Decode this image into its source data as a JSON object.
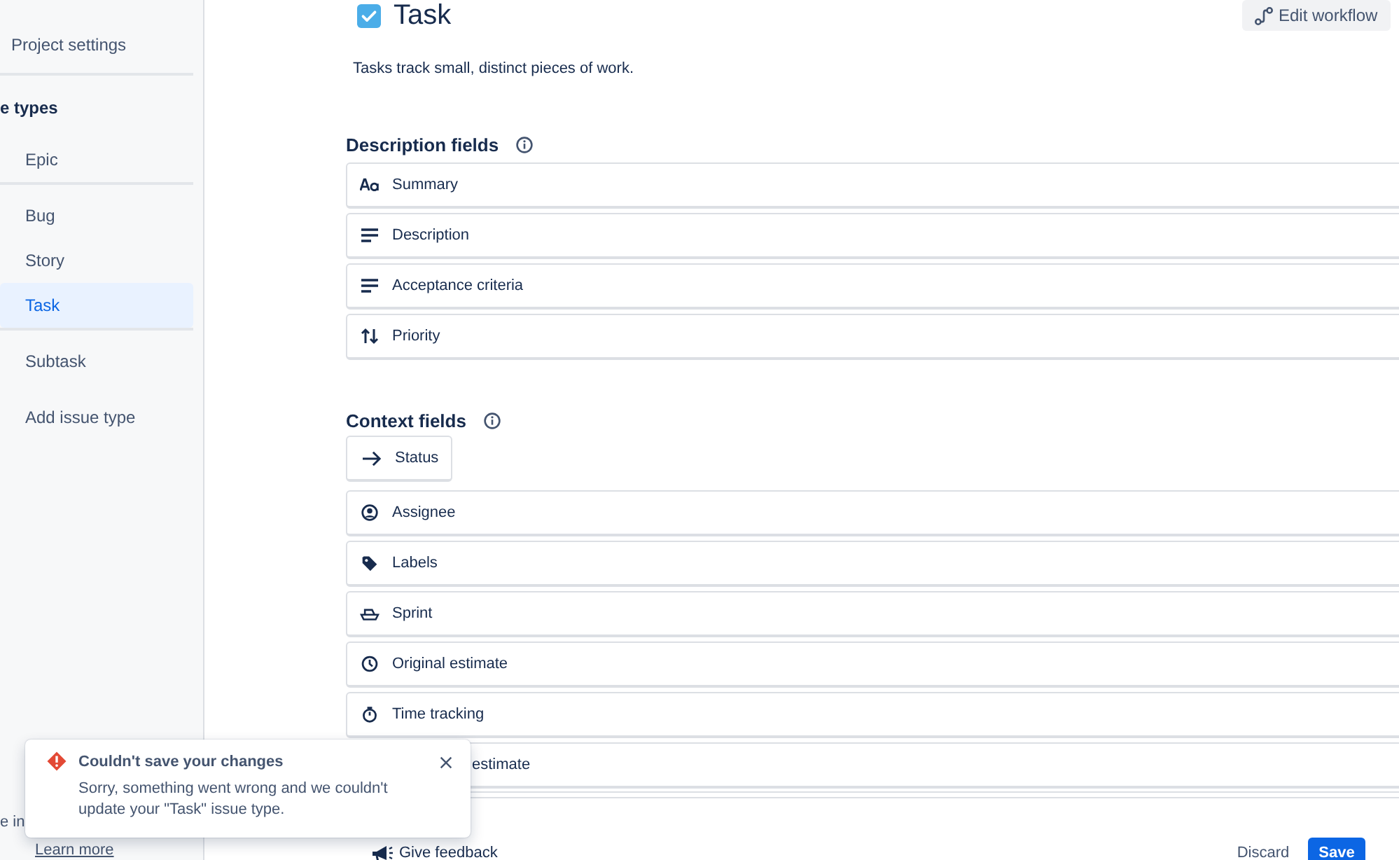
{
  "sidebar": {
    "back_link": "Project settings",
    "section_title": "e types",
    "groups": [
      [
        {
          "label": "Epic",
          "selected": false
        }
      ],
      [
        {
          "label": "Bug",
          "selected": false
        },
        {
          "label": "Story",
          "selected": false
        },
        {
          "label": "Task",
          "selected": true
        }
      ],
      [
        {
          "label": "Subtask",
          "selected": false
        }
      ]
    ],
    "add_link": "Add issue type",
    "note": "e in",
    "learn_more": "Learn more"
  },
  "header": {
    "title": "Task",
    "checked": true,
    "description": "Tasks track small, distinct pieces of work.",
    "edit_button": "Edit workflow"
  },
  "description_fields": {
    "title": "Description fields",
    "items": [
      {
        "label": "Summary",
        "kind": "text"
      },
      {
        "label": "Description",
        "kind": "paragraph"
      },
      {
        "label": "Acceptance criteria",
        "kind": "paragraph"
      },
      {
        "label": "Priority",
        "kind": "priority"
      }
    ]
  },
  "context_fields": {
    "title": "Context fields",
    "status": {
      "label": "Status",
      "kind": "status"
    },
    "items": [
      {
        "label": "Assignee",
        "kind": "user"
      },
      {
        "label": "Labels",
        "kind": "label"
      },
      {
        "label": "Sprint",
        "kind": "sprint"
      },
      {
        "label": "Original estimate",
        "kind": "clock"
      },
      {
        "label": "Time tracking",
        "kind": "timer"
      },
      {
        "label": "estimate",
        "kind": "covered"
      }
    ]
  },
  "footer": {
    "feedback": "Give feedback",
    "discard": "Discard",
    "save": "Save"
  },
  "toast": {
    "title": "Couldn't save your changes",
    "message": "Sorry, something went wrong and we couldn't update your \"Task\" issue type."
  }
}
